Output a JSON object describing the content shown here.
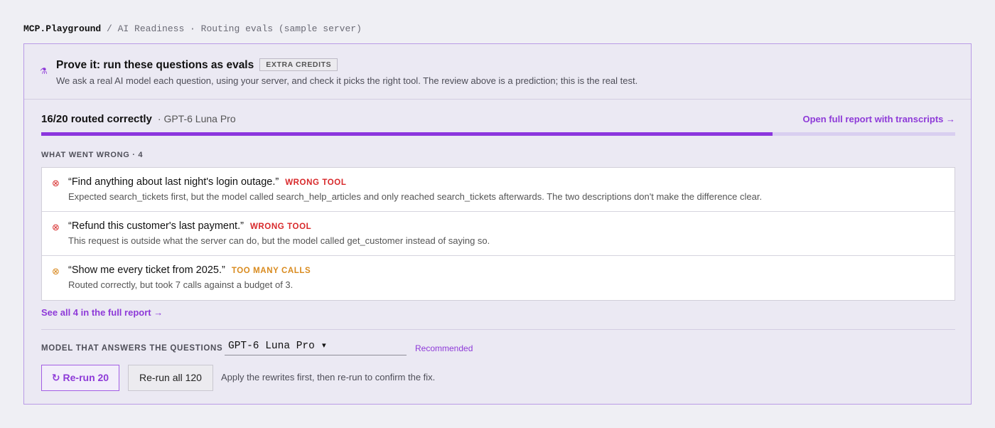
{
  "breadcrumb": {
    "brand": "MCP.Playground",
    "path": "/ AI Readiness · Routing evals (sample server)"
  },
  "header": {
    "icon": "flask-icon",
    "title": "Prove it: run these questions as evals",
    "badge": "EXTRA CREDITS",
    "subtitle": "We ask a real AI model each question, using your server, and check it picks the right tool. The review above is a prediction; this is the real test."
  },
  "summary": {
    "score": "16/20 routed correctly",
    "model": "· GPT-6 Luna Pro",
    "report_link": "Open full report with transcripts →",
    "progress_fraction": 0.8
  },
  "issues_section": {
    "label": "WHAT WENT WRONG · 4",
    "items": [
      {
        "question": "“Find anything about last night's login outage.”",
        "tag": "WRONG TOOL",
        "severity_color": "#d8292b",
        "icon": "error-circle-icon",
        "detail": "Expected search_tickets first, but the model called search_help_articles and only reached search_tickets afterwards. The two descriptions don't make the difference clear."
      },
      {
        "question": "“Refund this customer's last payment.”",
        "tag": "WRONG TOOL",
        "severity_color": "#d8292b",
        "icon": "error-circle-icon",
        "detail": "This request is outside what the server can do, but the model called get_customer instead of saying so."
      },
      {
        "question": "“Show me every ticket from 2025.”",
        "tag": "TOO MANY CALLS",
        "severity_color": "#d98b1f",
        "icon": "warning-circle-icon",
        "detail": "Routed correctly, but took 7 calls against a budget of 3."
      }
    ],
    "see_all": "See all 4 in the full report →"
  },
  "model_picker": {
    "label": "MODEL THAT ANSWERS THE QUESTIONS",
    "selected": "GPT-6 Luna Pro ▾",
    "note": "Recommended"
  },
  "actions": {
    "rerun_primary": "↻ Re-run 20",
    "rerun_all": "Re-run all 120",
    "help": "Apply the rewrites first, then re-run to confirm the fix."
  },
  "colors": {
    "accent": "#8e3ad8",
    "error": "#d8292b",
    "warning": "#d98b1f"
  }
}
